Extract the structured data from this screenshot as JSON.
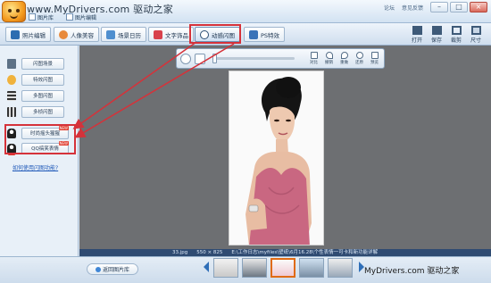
{
  "titlebar": {
    "watermark": "www.MyDrivers.com 驱动之家",
    "tabs": [
      {
        "label": "图片库"
      },
      {
        "label": "图片编辑"
      }
    ],
    "links": [
      "论坛",
      "意见反馈"
    ]
  },
  "toolbar": {
    "buttons": [
      {
        "label": "照片编辑",
        "icon": "photo-edit-icon"
      },
      {
        "label": "人像美容",
        "icon": "portrait-beauty-icon"
      },
      {
        "label": "场景日历",
        "icon": "calendar-icon"
      },
      {
        "label": "文字饰品",
        "icon": "text-decoration-icon"
      },
      {
        "label": "动感闪图",
        "icon": "flash-image-icon"
      },
      {
        "label": "PS特效",
        "icon": "ps-effect-icon"
      }
    ],
    "right": [
      {
        "label": "打开",
        "icon": "open-icon"
      },
      {
        "label": "保存",
        "icon": "save-icon"
      },
      {
        "label": "裁剪",
        "icon": "crop-icon"
      },
      {
        "label": "尺寸",
        "icon": "size-icon"
      }
    ]
  },
  "left_panel": {
    "items": [
      {
        "label": "闪图场景",
        "icon": "scene-icon"
      },
      {
        "label": "特效闪图",
        "icon": "effect-icon"
      },
      {
        "label": "多图闪图",
        "icon": "film-icon"
      },
      {
        "label": "多桢闪图",
        "icon": "frames-icon"
      },
      {
        "label": "时尚摇头猩猩",
        "icon": "penguin-icon",
        "badge": "NEW"
      },
      {
        "label": "QQ搞笑表情",
        "icon": "penguin-icon",
        "badge": "NEW"
      }
    ],
    "help_link": "如何使用闪图功能?"
  },
  "canvas_tools": [
    {
      "label": "",
      "icon": "rotate-icon"
    },
    {
      "label": "",
      "icon": "fit-icon"
    },
    {
      "label": "",
      "icon": "zoom-slider-icon"
    },
    {
      "label": "对比",
      "icon": "compare-icon"
    },
    {
      "label": "撤销",
      "icon": "undo-icon"
    },
    {
      "label": "重做",
      "icon": "redo-icon"
    },
    {
      "label": "还原",
      "icon": "restore-icon"
    },
    {
      "label": "预览",
      "icon": "preview-icon"
    }
  ],
  "status": {
    "zoom": "33.jpg",
    "size": "550 × 825",
    "path": "E:\\工作日志\\myfiles\\壁纸\\6月16.28\\个性表情一可卡和新功能详解"
  },
  "bottom": {
    "back_label": "返回图片库",
    "watermark": "MyDrivers.com 驱动之家"
  },
  "colors": {
    "highlight": "#d5323a",
    "accent": "#3f86d6",
    "dress": "#c96781"
  }
}
